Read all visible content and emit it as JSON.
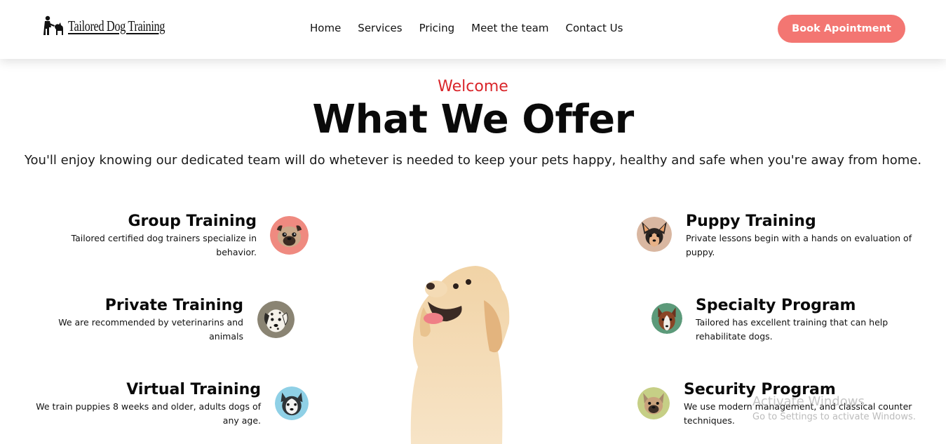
{
  "header": {
    "logo_text": "Tailored Dog Training",
    "nav": [
      "Home",
      "Services",
      "Pricing",
      "Meet the team",
      "Contact Us"
    ],
    "cta_label": "Book Apointment"
  },
  "hero": {
    "eyebrow": "Welcome",
    "title": "What We Offer",
    "lead": "You'll enjoy knowing our dedicated team will do whetever is needed to keep your pets happy, healthy and safe when you're away from home."
  },
  "services_left": [
    {
      "title": "Group Training",
      "desc": "Tailored certified dog trainers specialize in behavior.",
      "icon": "pug-icon"
    },
    {
      "title": "Private Training",
      "desc": "We are recommended by veterinarins and animals",
      "icon": "dalmatian-icon"
    },
    {
      "title": "Virtual Training",
      "desc": "We train puppies 8 weeks and older, adults dogs of any age.",
      "icon": "husky-icon"
    }
  ],
  "services_right": [
    {
      "title": "Puppy Training",
      "desc": "Private lessons begin with a hands on evaluation of puppy.",
      "icon": "chihuahua-icon"
    },
    {
      "title": "Specialty Program",
      "desc": "Tailored has excellent training that can help rehabilitate dogs.",
      "icon": "collie-icon"
    },
    {
      "title": "Security Program",
      "desc": "We use modern management, and classical counter techniques.",
      "icon": "bulldog-icon"
    }
  ],
  "os_overlay": {
    "line1": "Activate Windows",
    "line2": "Go to Settings to activate Windows."
  },
  "colors": {
    "accent": "#f37672",
    "welcome": "#d9252a",
    "pug_bg": "#ef8a80",
    "dalmatian_bg": "#8a8473",
    "husky_bg": "#8fd0e6",
    "chihuahua_bg": "#d9b7a1",
    "collie_bg": "#5c9a7a",
    "bulldog_bg": "#c6cf86"
  }
}
